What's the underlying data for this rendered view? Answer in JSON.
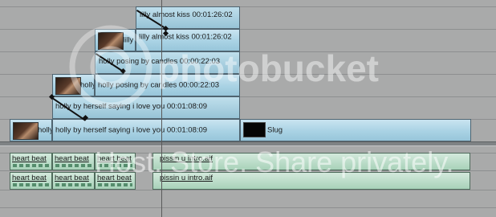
{
  "timeline": {
    "video_clips": [
      {
        "label": "lilly almost kiss  00:01:26:02"
      },
      {
        "label": "lilly"
      },
      {
        "label": "lilly almost kiss  00:01:26:02"
      },
      {
        "label": "holly posing by candles  00:00:22:03"
      },
      {
        "label": "holly"
      },
      {
        "label": "holly posing by candles  00:00:22:03"
      },
      {
        "label": "holly by herself saying i love you  00:01:08:09"
      },
      {
        "label": "holly"
      },
      {
        "label": "holly by herself saying i love you  00:01:08:09"
      },
      {
        "label": "Slug"
      }
    ],
    "audio_clips": [
      {
        "label": "heart beat"
      },
      {
        "label": "heart beat"
      },
      {
        "label": "heart beat"
      },
      {
        "label": "pissin u intro.aif"
      },
      {
        "label": "heart beat"
      },
      {
        "label": "heart beat"
      },
      {
        "label": "heart beat"
      },
      {
        "label": "pissin u intro.aif"
      }
    ]
  },
  "watermark": {
    "brand": "photobucket",
    "tagline": "Host. Store. Share privately."
  },
  "colors": {
    "video_clip": "#a9d2e4",
    "audio_clip": "#b2d8c3",
    "background": "#a9aaaa"
  }
}
